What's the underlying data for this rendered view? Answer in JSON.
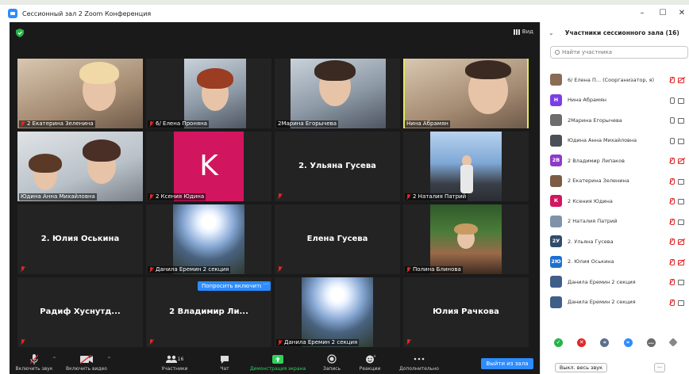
{
  "window": {
    "title": "Сессионный зал 2  Zoom Конференция",
    "minimize": "–",
    "maximize": "☐",
    "close": "✕"
  },
  "stage": {
    "view_label": "Вид",
    "ask_unmute_label": "Попросить включить",
    "ask_more_label": "···",
    "tiles": [
      {
        "name": "2 Екатерина Зеленина",
        "muted": true,
        "active": false
      },
      {
        "name": "6/ Елена Проняна",
        "muted": true,
        "active": false
      },
      {
        "name": "2Марина Егорычева",
        "muted": false,
        "active": false
      },
      {
        "name": "Нина Абрамян",
        "muted": false,
        "active": true
      },
      {
        "name": "Юдина Анна Михайловна",
        "muted": false,
        "active": false
      },
      {
        "name": "2 Ксения Юдина",
        "muted": true,
        "avatar_letter": "K",
        "active": false
      },
      {
        "big_name": "2. Ульяна Гусева",
        "muted": true,
        "active": false
      },
      {
        "name": "2 Наталия Патрий",
        "muted": true,
        "active": false
      },
      {
        "big_name": "2. Юлия Оськина",
        "muted": true,
        "active": false
      },
      {
        "name": "Данила Еремин 2 секция",
        "muted": true,
        "active": false
      },
      {
        "big_name": "Елена Гусева",
        "muted": true,
        "active": false
      },
      {
        "name": "Полина Блинова",
        "muted": true,
        "active": false
      },
      {
        "big_name": "Радиф Хуснутд...",
        "muted": true,
        "active": false
      },
      {
        "big_name": "2 Владимир Ли...",
        "muted": true,
        "active": false
      },
      {
        "name": "Данила Еремин 2 секция",
        "muted": true,
        "active": false
      },
      {
        "big_name": "Юлия Рачкова",
        "muted": true,
        "active": false
      }
    ]
  },
  "toolbar": {
    "unmute": "Включить звук",
    "start_video": "Включить видео",
    "participants": "Участники",
    "participants_count": "16",
    "chat": "Чат",
    "share": "Демонстрация экрана",
    "record": "Запись",
    "reactions": "Реакции",
    "more": "Дополнительно",
    "leave": "Выйти из зала"
  },
  "panel": {
    "title": "Участники сессионного зала (16)",
    "search_placeholder": "Найти участника",
    "participants": [
      {
        "name": "6/ Елена П...  (Соорганизатор, я)",
        "avatar": "",
        "avatar_color": "#8a6b55",
        "mic": "off",
        "cam": "off"
      },
      {
        "name": "Нина Абрамян",
        "avatar": "Н",
        "avatar_color": "#7b3fe4",
        "mic": "on",
        "cam": "on"
      },
      {
        "name": "2Марина Егорычева",
        "avatar": "",
        "avatar_color": "#6d6d6d",
        "mic": "on",
        "cam": "on"
      },
      {
        "name": "Юдина Анна Михайловна",
        "avatar": "",
        "avatar_color": "#4b4f57",
        "mic": "on",
        "cam": "on"
      },
      {
        "name": "2 Владимир Липаков",
        "avatar": "2В",
        "avatar_color": "#8e3ac9",
        "mic": "off",
        "cam": "off"
      },
      {
        "name": "2 Екатерина Зеленина",
        "avatar": "",
        "avatar_color": "#7d5a44",
        "mic": "off",
        "cam": "on"
      },
      {
        "name": "2 Ксения Юдина",
        "avatar": "К",
        "avatar_color": "#d2155f",
        "mic": "off",
        "cam": "on"
      },
      {
        "name": "2 Наталия Патрий",
        "avatar": "",
        "avatar_color": "#7f93a8",
        "mic": "off",
        "cam": "on"
      },
      {
        "name": "2. Ульяна Гусева",
        "avatar": "2У",
        "avatar_color": "#2f4d6b",
        "mic": "off",
        "cam": "off"
      },
      {
        "name": "2. Юлия Оськина",
        "avatar": "2Ю",
        "avatar_color": "#1e6fd0",
        "mic": "off",
        "cam": "off"
      },
      {
        "name": "Данила Еремин 2 секция",
        "avatar": "",
        "avatar_color": "#3f5f88",
        "mic": "off",
        "cam": "on"
      },
      {
        "name": "Данила Еремин 2 секция",
        "avatar": "",
        "avatar_color": "#3f5f88",
        "mic": "off",
        "cam": "on"
      }
    ],
    "mute_all": "Выкл. весь звук",
    "more": "..."
  },
  "colors": {
    "accent": "#2d8cff",
    "active_speaker": "#e2e85f",
    "muted_red": "#e02828",
    "share_green": "#2fd25a"
  }
}
